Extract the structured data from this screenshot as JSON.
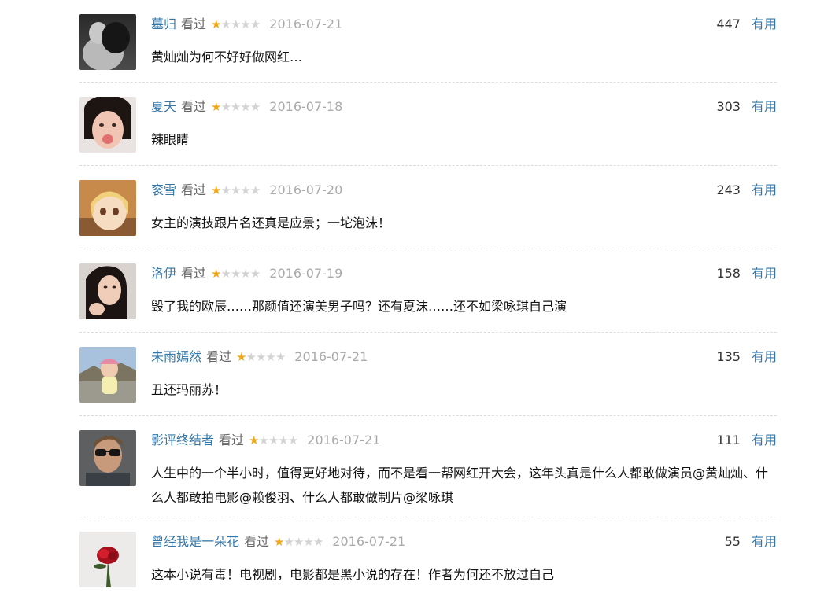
{
  "status_label": "看过",
  "useful_label": "有用",
  "star_colors": {
    "filled": "#f2a81d",
    "empty": "#d3d3d3"
  },
  "comments": [
    {
      "user": "墓归",
      "rating": 1,
      "max_rating": 5,
      "date": "2016-07-21",
      "votes": "447",
      "text": "黄灿灿为何不好好做网红…",
      "avatar_icon": "user-avatar-icon"
    },
    {
      "user": "夏天",
      "rating": 1,
      "max_rating": 5,
      "date": "2016-07-18",
      "votes": "303",
      "text": "辣眼睛",
      "avatar_icon": "user-avatar-icon"
    },
    {
      "user": "衮雪",
      "rating": 1,
      "max_rating": 5,
      "date": "2016-07-20",
      "votes": "243",
      "text": "女主的演技跟片名还真是应景；一坨泡沫！",
      "avatar_icon": "user-avatar-icon"
    },
    {
      "user": "洛伊",
      "rating": 1,
      "max_rating": 5,
      "date": "2016-07-19",
      "votes": "158",
      "text": "毁了我的欧辰……那颜值还演美男子吗？还有夏沫……还不如梁咏琪自己演",
      "avatar_icon": "user-avatar-icon"
    },
    {
      "user": "未雨嫣然",
      "rating": 1,
      "max_rating": 5,
      "date": "2016-07-21",
      "votes": "135",
      "text": "丑还玛丽苏！",
      "avatar_icon": "user-avatar-icon"
    },
    {
      "user": "影评终结者",
      "rating": 1,
      "max_rating": 5,
      "date": "2016-07-21",
      "votes": "111",
      "text": "人生中的一个半小时，值得更好地对待，而不是看一帮网红开大会，这年头真是什么人都敢做演员@黄灿灿、什么人都敢拍电影@赖俊羽、什么人都敢做制片@梁咏琪",
      "avatar_icon": "user-avatar-icon"
    },
    {
      "user": "曾经我是一朵花",
      "rating": 1,
      "max_rating": 5,
      "date": "2016-07-21",
      "votes": "55",
      "text": "这本小说有毒！电视剧，电影都是黑小说的存在！作者为何还不放过自己",
      "avatar_icon": "user-avatar-icon"
    }
  ]
}
